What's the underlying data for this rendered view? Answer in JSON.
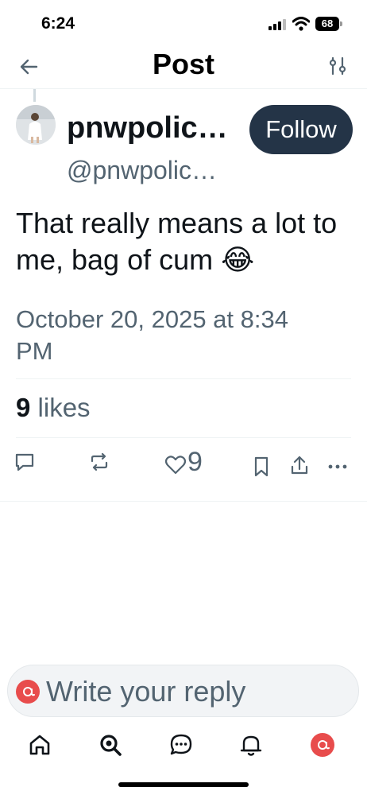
{
  "status": {
    "time": "6:24",
    "battery": "68"
  },
  "header": {
    "title": "Post"
  },
  "author": {
    "name": "pnwpolic…",
    "handle": "@pnwpolic…"
  },
  "follow_label": "Follow",
  "post": {
    "text": "That really means a lot to me, bag of cum 😂",
    "date": "October 20, 2025 at 8:34 PM"
  },
  "stats": {
    "likes_count": "9",
    "likes_label": "likes"
  },
  "actions": {
    "like_count": "9"
  },
  "reply": {
    "placeholder": "Write your reply"
  },
  "colors": {
    "accent": "#243447",
    "muted": "#536471",
    "reply_avatar": "#e84c4c"
  }
}
